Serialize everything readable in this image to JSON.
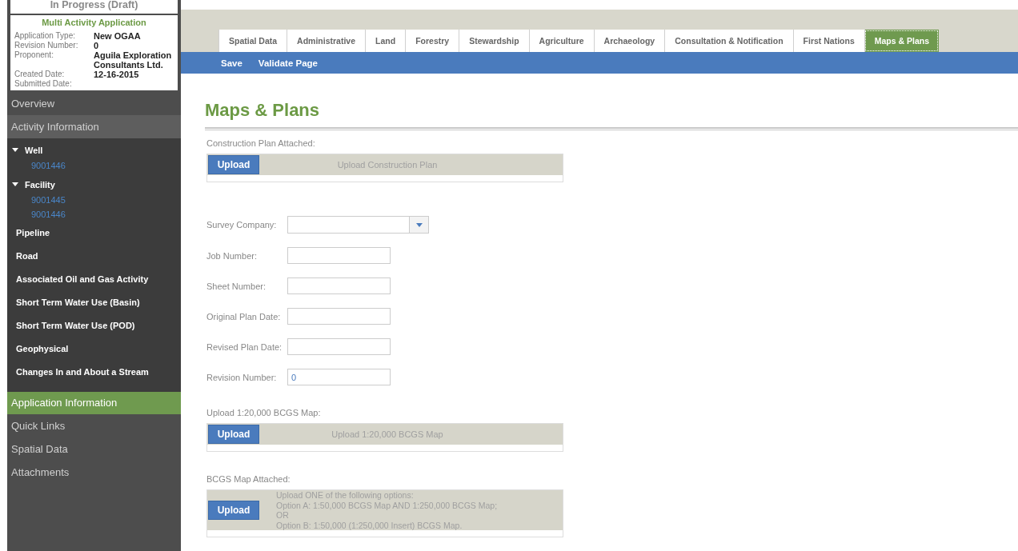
{
  "sidebar": {
    "status": "In Progress (Draft)",
    "app_title": "Multi Activity Application",
    "details": [
      {
        "label": "Application Type:",
        "value": "New OGAA"
      },
      {
        "label": "Revision Number:",
        "value": "0"
      },
      {
        "label": "Proponent:",
        "value": "Aguila Exploration Consultants Ltd."
      },
      {
        "label": "Created Date:",
        "value": "12-16-2015"
      },
      {
        "label": "Submitted Date:"
      }
    ],
    "nav": [
      {
        "kind": "section",
        "label": "Overview",
        "selected": false
      },
      {
        "kind": "section",
        "label": "Activity Information",
        "selected": false,
        "shaded": true
      },
      {
        "kind": "activities",
        "items": [
          {
            "label": "Well",
            "expanded": true,
            "children": [
              {
                "label": "9001446"
              }
            ]
          },
          {
            "label": "Facility",
            "expanded": true,
            "children": [
              {
                "label": "9001445"
              },
              {
                "label": "9001446"
              }
            ]
          },
          {
            "label": "Pipeline"
          },
          {
            "label": "Road"
          },
          {
            "label": "Associated Oil and Gas Activity"
          },
          {
            "label": "Short Term Water Use (Basin)"
          },
          {
            "label": "Short Term Water Use (POD)"
          },
          {
            "label": "Geophysical"
          },
          {
            "label": "Changes In and About a Stream"
          }
        ]
      },
      {
        "kind": "section",
        "label": "Application Information",
        "selected": true
      },
      {
        "kind": "section",
        "label": "Quick Links",
        "selected": false
      },
      {
        "kind": "section",
        "label": "Spatial Data",
        "selected": false
      },
      {
        "kind": "section",
        "label": "Attachments",
        "selected": false
      }
    ]
  },
  "tabs": [
    {
      "label": "Spatial Data",
      "selected": false
    },
    {
      "label": "Administrative",
      "selected": false
    },
    {
      "label": "Land",
      "selected": false
    },
    {
      "label": "Forestry",
      "selected": false
    },
    {
      "label": "Stewardship",
      "selected": false
    },
    {
      "label": "Agriculture",
      "selected": false
    },
    {
      "label": "Archaeology",
      "selected": false
    },
    {
      "label": "Consultation & Notification",
      "selected": false
    },
    {
      "label": "First Nations",
      "selected": false
    },
    {
      "label": "Maps & Plans",
      "selected": true
    }
  ],
  "toolbar": [
    "Save",
    "Validate Page"
  ],
  "content": {
    "title": "Maps & Plans",
    "items": [
      {
        "kind": "upload",
        "label": "Construction Plan Attached:",
        "button": "Upload",
        "hint": [
          "Upload Construction Plan"
        ]
      },
      {
        "kind": "select",
        "label": "Survey Company:"
      },
      {
        "kind": "field",
        "label": "Job Number:"
      },
      {
        "kind": "field",
        "label": "Sheet Number:"
      },
      {
        "kind": "field",
        "label": "Original Plan Date:"
      },
      {
        "kind": "field",
        "label": "Revised Plan Date:"
      },
      {
        "kind": "field",
        "label": "Revision Number:",
        "value": "0"
      },
      {
        "kind": "upload",
        "label": "Upload 1:20,000 BCGS Map:",
        "button": "Upload",
        "hint": [
          "Upload 1:20,000 BCGS Map"
        ]
      },
      {
        "kind": "upload",
        "label": "BCGS Map Attached:",
        "button": "Upload",
        "hint": [
          "Upload ONE of the following options:",
          "Option A: 1:50,000 BCGS Map AND 1:250,000 BCGS Map;",
          "OR",
          "Option B: 1:50,000 (1:250,000 Insert) BCGS Map."
        ]
      }
    ]
  }
}
